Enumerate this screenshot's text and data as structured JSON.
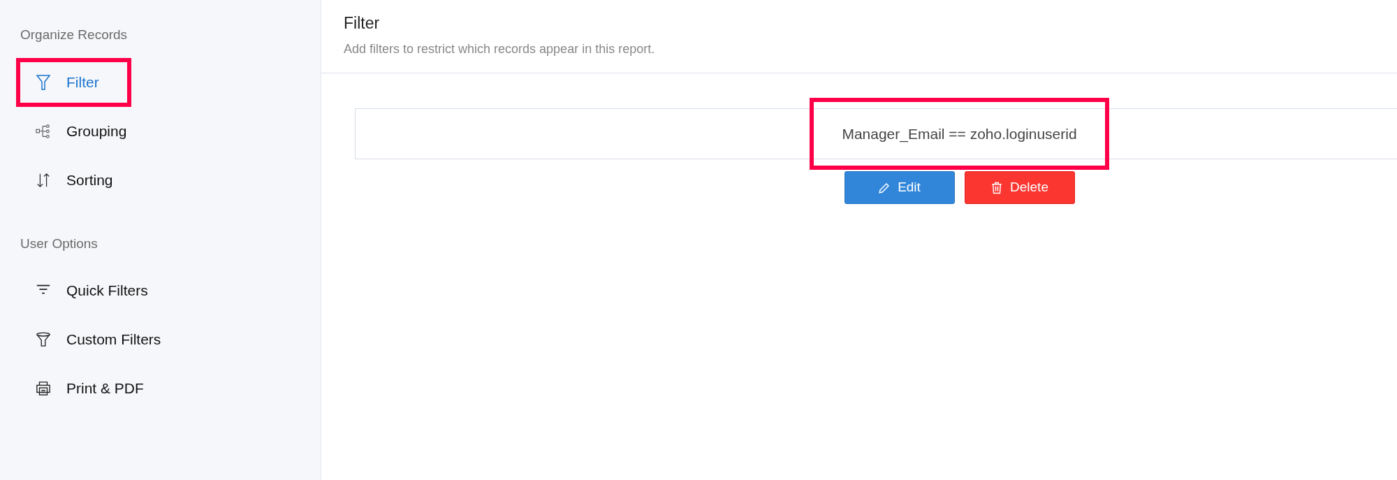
{
  "sidebar": {
    "sections": [
      {
        "heading": "Organize Records",
        "items": [
          {
            "kind": "filter",
            "label": "Filter",
            "selected": true,
            "highlighted": true
          },
          {
            "kind": "grouping",
            "label": "Grouping",
            "selected": false,
            "highlighted": false
          },
          {
            "kind": "sorting",
            "label": "Sorting",
            "selected": false,
            "highlighted": false
          }
        ]
      },
      {
        "heading": "User Options",
        "items": [
          {
            "kind": "quick-filter",
            "label": "Quick Filters",
            "selected": false,
            "highlighted": false
          },
          {
            "kind": "funnel",
            "label": "Custom Filters",
            "selected": false,
            "highlighted": false
          },
          {
            "kind": "print",
            "label": "Print & PDF",
            "selected": false,
            "highlighted": false
          }
        ]
      }
    ]
  },
  "header": {
    "title": "Filter",
    "subtitle": "Add filters to restrict which records appear in this report."
  },
  "filter_condition": {
    "text": "Manager_Email == zoho.loginuserid",
    "highlighted": true
  },
  "buttons": [
    {
      "kind": "edit",
      "label": "Edit"
    },
    {
      "kind": "delete",
      "label": "Delete"
    }
  ]
}
